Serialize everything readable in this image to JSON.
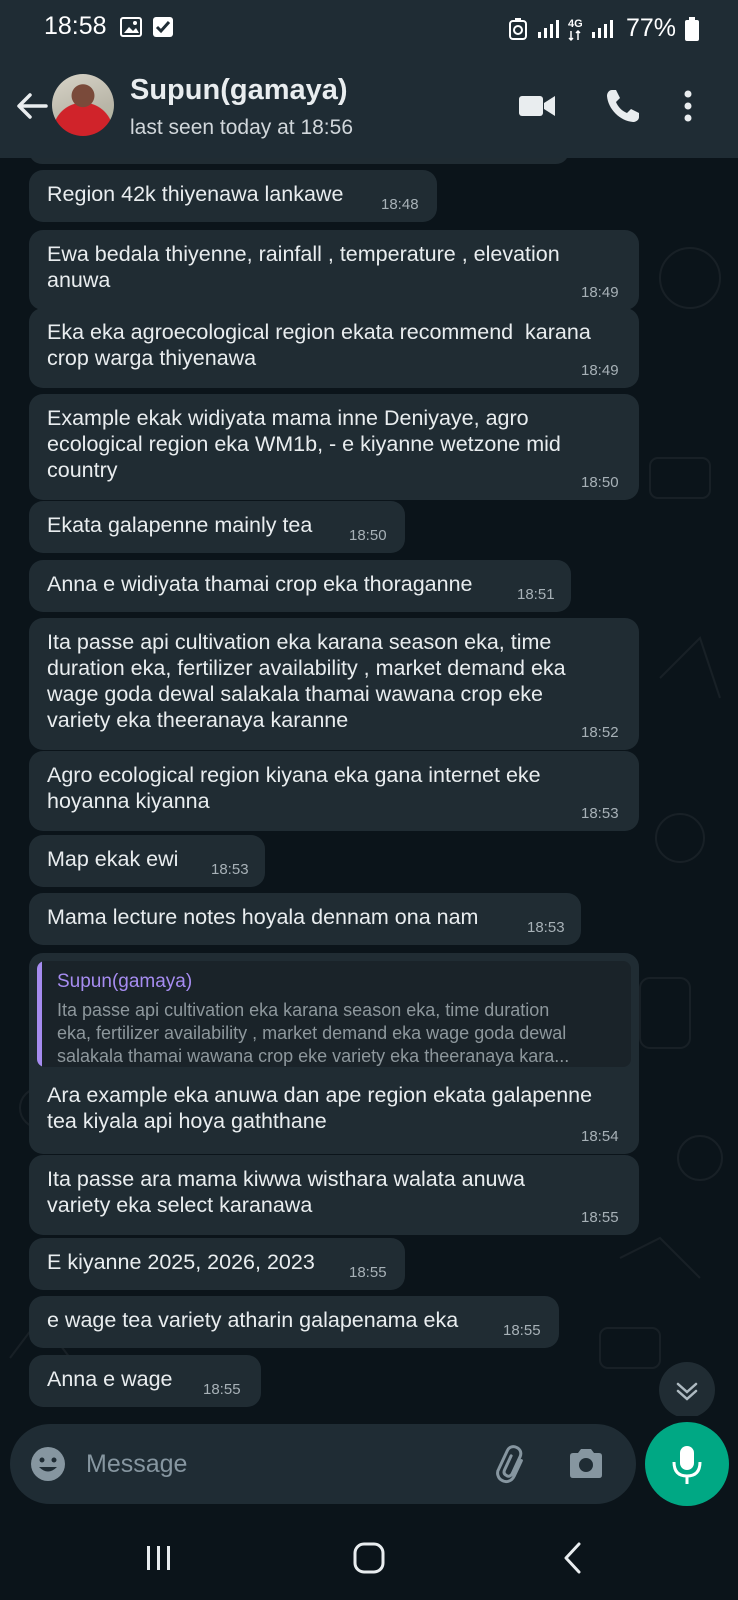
{
  "status_bar": {
    "time": "18:58",
    "battery": "77%",
    "left_icons": [
      "gallery-icon",
      "checkbox-icon"
    ],
    "right_icons": [
      "recycle-icon",
      "signal-icon",
      "4g-signal-icon",
      "battery-icon"
    ]
  },
  "header": {
    "contact_name": "Supun(gamaya)",
    "last_seen": "last seen today at 18:56",
    "icons": [
      "back-arrow-icon",
      "video-call-icon",
      "phone-icon",
      "more-vert-icon"
    ]
  },
  "messages": [
    {
      "lines": [
        "Region 42k thiyenawa lankawe"
      ],
      "time": "18:48"
    },
    {
      "lines": [
        "Ewa bedala thiyenne, rainfall , temperature , elevation",
        "anuwa"
      ],
      "time": "18:49"
    },
    {
      "lines": [
        "Eka eka agroecological region ekata recommend  karana",
        "crop warga thiyenawa"
      ],
      "time": "18:49"
    },
    {
      "lines": [
        "Example ekak widiyata mama inne Deniyaye, agro",
        "ecological region eka WM1b, - e kiyanne wetzone mid",
        "country"
      ],
      "time": "18:50"
    },
    {
      "lines": [
        "Ekata galapenne mainly tea"
      ],
      "time": "18:50"
    },
    {
      "lines": [
        "Anna e widiyata thamai crop eka thoraganne"
      ],
      "time": "18:51"
    },
    {
      "lines": [
        "Ita passe api cultivation eka karana season eka, time",
        "duration eka, fertilizer availability , market demand eka",
        "wage goda dewal salakala thamai wawana crop eke",
        "variety eka theeranaya karanne"
      ],
      "time": "18:52"
    },
    {
      "lines": [
        "Agro ecological region kiyana eka gana internet eke",
        "hoyanna kiyanna"
      ],
      "time": "18:53"
    },
    {
      "lines": [
        "Map ekak ewi"
      ],
      "time": "18:53"
    },
    {
      "lines": [
        "Mama lecture notes hoyala dennam ona nam"
      ],
      "time": "18:53"
    },
    {
      "quote": {
        "author": "Supun(gamaya)",
        "lines": [
          "Ita passe api cultivation eka karana season eka, time duration",
          "eka, fertilizer availability , market demand eka wage goda dewal",
          "salakala thamai wawana crop eke variety eka theeranaya kara..."
        ]
      },
      "lines": [
        "Ara example eka anuwa dan ape region ekata galapenne",
        "tea kiyala api hoya gaththane"
      ],
      "time": "18:54"
    },
    {
      "lines": [
        "Ita passe ara mama kiwwa wisthara walata anuwa",
        "variety eka select karanawa"
      ],
      "time": "18:55"
    },
    {
      "lines": [
        "E kiyanne 2025, 2026, 2023"
      ],
      "time": "18:55"
    },
    {
      "lines": [
        "e wage tea variety atharin galapenama eka"
      ],
      "time": "18:55"
    },
    {
      "lines": [
        "Anna e wage"
      ],
      "time": "18:55"
    }
  ],
  "composer": {
    "placeholder": "Message",
    "icons": [
      "emoji-icon",
      "attach-icon",
      "camera-icon",
      "mic-icon"
    ]
  },
  "scroll_down_icon": "chevron-double-down-icon",
  "nav_bar": {
    "icons": [
      "recent-apps-icon",
      "home-icon",
      "back-icon"
    ]
  },
  "colors": {
    "header_bg": "#1f2c34",
    "chat_bg": "#0b141a",
    "bubble_bg": "#202c33",
    "accent_green": "#00a884",
    "quote_author": "#a68cf0"
  }
}
